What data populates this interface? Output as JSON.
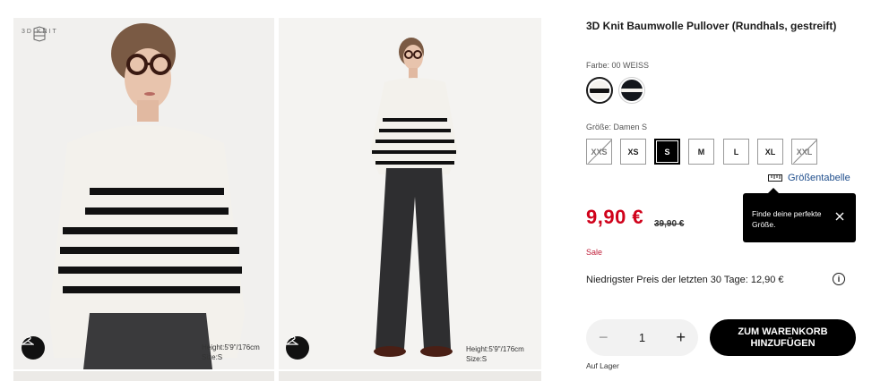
{
  "gallery": {
    "brand_text": "3D KNIT",
    "images": [
      {
        "alt": "model-closeup",
        "model_height": "Height:5'9\"/176cm",
        "model_size": "Size:S"
      },
      {
        "alt": "model-full-body",
        "model_height": "Height:5'9\"/176cm",
        "model_size": "Size:S"
      }
    ]
  },
  "product": {
    "title": "3D Knit Baumwolle Pullover (Rundhals, gestreift)",
    "color_label": "Farbe: 00 WEISS",
    "swatches": [
      {
        "name": "white-striped",
        "base": "#f5f3ee",
        "stripe": "#111111",
        "selected": true
      },
      {
        "name": "navy-striped",
        "base": "#14171c",
        "stripe": "#f5f3ee",
        "selected": false
      }
    ],
    "size_label": "Größe: Damen S",
    "sizes": [
      {
        "label": "XXS",
        "state": "unavailable"
      },
      {
        "label": "XS",
        "state": "available"
      },
      {
        "label": "S",
        "state": "selected"
      },
      {
        "label": "M",
        "state": "available"
      },
      {
        "label": "L",
        "state": "available"
      },
      {
        "label": "XL",
        "state": "available"
      },
      {
        "label": "XXL",
        "state": "unavailable"
      }
    ],
    "size_chart_label": "Größentabelle",
    "tooltip_text": "Finde deine perfekte Größe.",
    "price": "9,90 €",
    "old_price": "39,90 €",
    "sale_label": "Sale",
    "lowest_price": "Niedrigster Preis der letzten 30 Tage: 12,90 €",
    "info_icon": "i",
    "quantity": "1",
    "minus": "−",
    "plus": "+",
    "add_to_cart": "ZUM WARENKORB HINZUFÜGEN",
    "stock": "Auf Lager"
  },
  "colors": {
    "sale_red": "#d0021b",
    "link_blue": "#1f4e8c"
  }
}
